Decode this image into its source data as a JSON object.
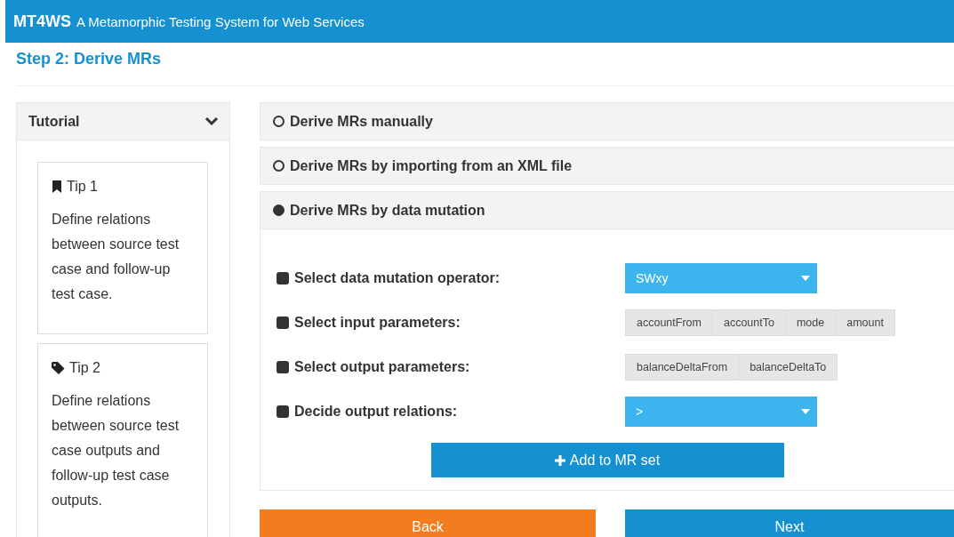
{
  "header": {
    "brand": "MT4WS",
    "subtitle": "A Metamorphic Testing System for Web Services"
  },
  "step_title": "Step 2: Derive MRs",
  "tutorial": {
    "title": "Tutorial",
    "expanded": true,
    "tips": [
      {
        "kind": "bookmark",
        "title": "Tip 1",
        "text": "Define relations between source test case and follow-up test case."
      },
      {
        "kind": "tag",
        "title": "Tip 2",
        "text": "Define relations between source test case outputs and follow-up test case outputs."
      }
    ]
  },
  "options": [
    {
      "label": "Derive MRs manually",
      "selected": false
    },
    {
      "label": "Derive MRs by importing from an XML file",
      "selected": false
    },
    {
      "label": "Derive MRs by data mutation",
      "selected": true
    }
  ],
  "form": {
    "rows": [
      {
        "kind": "select",
        "label": "Select data mutation operator:",
        "value": "SWxy"
      },
      {
        "kind": "tags",
        "label": "Select input parameters:",
        "tags": [
          "accountFrom",
          "accountTo",
          "mode",
          "amount"
        ]
      },
      {
        "kind": "tags",
        "label": "Select output parameters:",
        "tags": [
          "balanceDeltaFrom",
          "balanceDeltaTo"
        ]
      },
      {
        "kind": "select",
        "label": "Decide output relations:",
        "value": ">"
      }
    ],
    "add_button": "Add to MR set"
  },
  "buttons": [
    {
      "kind": "back",
      "label": "Back"
    },
    {
      "kind": "next",
      "label": "Next"
    }
  ]
}
